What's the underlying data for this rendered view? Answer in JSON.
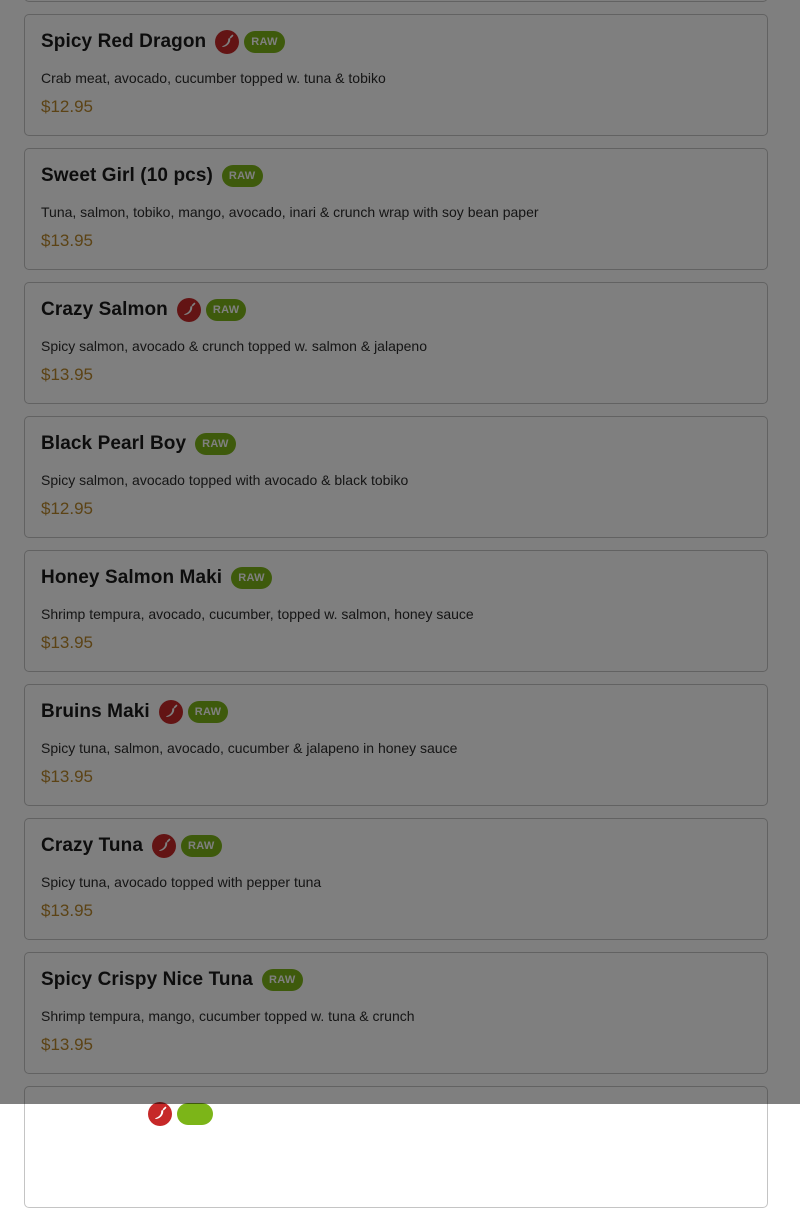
{
  "colors": {
    "raw_badge": "#7cb518",
    "spicy_icon": "#c62828",
    "price": "#b8862a",
    "overlay": "rgba(0,0,0,0.5)"
  },
  "menu": {
    "items": [
      {
        "name": "",
        "description": "",
        "price": "",
        "spicy": false,
        "raw": false
      },
      {
        "name": "Spicy Red Dragon",
        "description": "Crab meat, avocado, cucumber topped w. tuna & tobiko",
        "price": "$12.95",
        "spicy": true,
        "raw": true,
        "raw_label": "RAW",
        "spicy_icon": "chili-pepper-icon"
      },
      {
        "name": "Sweet Girl (10 pcs)",
        "description": "Tuna, salmon, tobiko, mango, avocado, inari & crunch wrap with soy bean paper",
        "price": "$13.95",
        "spicy": false,
        "raw": true,
        "raw_label": "RAW"
      },
      {
        "name": "Crazy Salmon",
        "description": "Spicy salmon, avocado & crunch topped w. salmon & jalapeno",
        "price": "$13.95",
        "spicy": true,
        "raw": true,
        "raw_label": "RAW",
        "spicy_icon": "chili-pepper-icon"
      },
      {
        "name": "Black Pearl Boy",
        "description": "Spicy salmon, avocado topped with avocado & black tobiko",
        "price": "$12.95",
        "spicy": false,
        "raw": true,
        "raw_label": "RAW"
      },
      {
        "name": "Honey Salmon Maki",
        "description": "Shrimp tempura, avocado, cucumber, topped w. salmon, honey sauce",
        "price": "$13.95",
        "spicy": false,
        "raw": true,
        "raw_label": "RAW"
      },
      {
        "name": "Bruins Maki",
        "description": "Spicy tuna, salmon, avocado, cucumber & jalapeno in honey sauce",
        "price": "$13.95",
        "spicy": true,
        "raw": true,
        "raw_label": "RAW",
        "spicy_icon": "chili-pepper-icon"
      },
      {
        "name": "Crazy Tuna",
        "description": "Spicy tuna, avocado topped with pepper tuna",
        "price": "$13.95",
        "spicy": true,
        "raw": true,
        "raw_label": "RAW",
        "spicy_icon": "chili-pepper-icon"
      },
      {
        "name": "Spicy Crispy Nice Tuna",
        "description": "Shrimp tempura, mango, cucumber topped w. tuna & crunch",
        "price": "$13.95",
        "spicy": false,
        "raw": true,
        "raw_label": "RAW"
      },
      {
        "name": "",
        "description": "",
        "price": "",
        "spicy": true,
        "raw": true,
        "raw_label": "",
        "spicy_icon": "chili-pepper-icon"
      }
    ]
  }
}
